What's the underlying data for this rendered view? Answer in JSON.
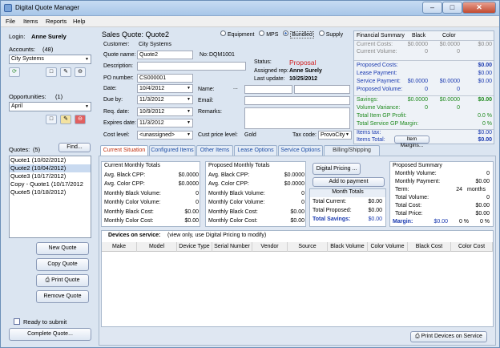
{
  "window": {
    "title": "Digital Quote Manager",
    "minimize": "–",
    "maximize": "□",
    "close": "✕"
  },
  "menu": [
    "File",
    "Items",
    "Reports",
    "Help"
  ],
  "left": {
    "login_label": "Login:",
    "login_user": "Anne Surely",
    "accounts_label": "Accounts:",
    "accounts_count": "(48)",
    "account_selected": "City Systems",
    "opportunities_label": "Opportunities:",
    "opportunities_count": "(1)",
    "opportunity_selected": "April",
    "quotes_label": "Quotes:",
    "quotes_count": "(5)",
    "find_label": "Find...",
    "quotes": [
      "Quote1 (10/02/2012)",
      "Quote2 (10/04/2012)",
      "Quote3 (10/17/2012)",
      "Copy - Quote1 (10/17/2012",
      "Quote5 (10/18/2012)"
    ],
    "new_quote": "New Quote",
    "copy_quote": "Copy Quote",
    "print_quote": "Print Quote",
    "remove_quote": "Remove Quote",
    "ready_label": "Ready to submit",
    "complete_quote": "Complete Quote..."
  },
  "header": {
    "title": "Sales Quote: Quote2",
    "radios": [
      "Equipment",
      "MPS",
      "Bundled",
      "Supply"
    ]
  },
  "form": {
    "customer_label": "Customer:",
    "customer": "City Systems",
    "quote_name_label": "Quote name:",
    "quote_name": "Quote2",
    "no_label": "No:",
    "no": "DQM1001",
    "description_label": "Description:",
    "po_label": "PO number:",
    "po": "CS000001",
    "status_label": "Status:",
    "status": "Proposal",
    "assigned_label": "Assigned rep:",
    "assigned": "Anne Surely",
    "last_update_label": "Last update:",
    "last_update": "10/25/2012",
    "date_label": "Date:",
    "date": "10/4/2012",
    "due_label": "Due by:",
    "due": "11/3/2012",
    "req_label": "Req. date:",
    "req": "10/9/2012",
    "expires_label": "Expires date:",
    "expires": "11/3/2012",
    "cost_level_label": "Cost level:",
    "cost_level": "<unassigned>",
    "name_label": "Name:",
    "name_btn": "...",
    "email_label": "Email:",
    "remarks_label": "Remarks:",
    "cust_price_label": "Cust price level:",
    "cust_price": "Gold",
    "tax_label": "Tax code:",
    "tax": "ProvoCity"
  },
  "financial": {
    "title": "Financial Summary",
    "col_black": "Black",
    "col_color": "Color",
    "current_costs_label": "Current Costs:",
    "current_costs_black": "$0.0000",
    "current_costs_color": "$0.0000",
    "current_costs_total": "$0.00",
    "current_volume_label": "Current Volume:",
    "current_volume_black": "0",
    "current_volume_color": "0",
    "proposed_costs_label": "Proposed Costs:",
    "proposed_costs_total": "$0.00",
    "lease_payment_label": "Lease Payment:",
    "lease_payment_total": "$0.00",
    "service_payment_label": "Service Payment:",
    "service_payment_black": "$0.0000",
    "service_payment_color": "$0.0000",
    "service_payment_total": "$0.00",
    "proposed_volume_label": "Proposed Volume:",
    "proposed_volume_black": "0",
    "proposed_volume_color": "0",
    "savings_label": "Savings:",
    "savings_black": "$0.0000",
    "savings_color": "$0.0000",
    "savings_total": "$0.00",
    "volume_variance_label": "Volume Variance:",
    "volume_variance_black": "0",
    "volume_variance_color": "0",
    "gp_profit_label": "Total Item GP Profit:",
    "gp_profit": "0.0 %",
    "gp_margin_label": "Total Service GP Margin:",
    "gp_margin": "0 %",
    "items_tax_label": "Items tax:",
    "items_tax": "$0.00",
    "items_total_label": "Items Total:",
    "item_margins_btn": "Item Margins...",
    "items_total": "$0.00"
  },
  "tabs": [
    "Current Situation",
    "Configured Items",
    "Other Items",
    "Lease Options",
    "Service Options",
    "Billing/Shipping"
  ],
  "current_monthly": {
    "title": "Current Monthly Totals",
    "rows": [
      [
        "Avg. Black CPP:",
        "$0.0000"
      ],
      [
        "Avg. Color CPP:",
        "$0.0000"
      ],
      [
        "Monthly Black Volume:",
        "0"
      ],
      [
        "Monthly Color Volume:",
        "0"
      ],
      [
        "Monthly Black Cost:",
        "$0.00"
      ],
      [
        "Monthly Color Cost:",
        "$0.00"
      ]
    ]
  },
  "proposed_monthly": {
    "title": "Proposed Monthly Totals",
    "rows": [
      [
        "Avg. Black CPP:",
        "$0.0000"
      ],
      [
        "Avg. Color CPP:",
        "$0.0000"
      ],
      [
        "Monthly Black Volume:",
        "0"
      ],
      [
        "Monthly Color Volume:",
        "0"
      ],
      [
        "Monthly Black Cost:",
        "$0.00"
      ],
      [
        "Monthly Color Cost:",
        "$0.00"
      ]
    ]
  },
  "digital": {
    "pricing_btn": "Digital Pricing ...",
    "add_payment_btn": "Add to payment",
    "month_totals_title": "Month Totals",
    "total_current_label": "Total Current:",
    "total_current": "$0.00",
    "total_proposed_label": "Total Proposed:",
    "total_proposed": "$0.00",
    "total_savings_label": "Total Savings:",
    "total_savings": "$0.00"
  },
  "proposed_summary": {
    "title": "Proposed Summary",
    "monthly_volume_label": "Monthly Volume:",
    "monthly_volume": "0",
    "monthly_payment_label": "Monthly Payment:",
    "monthly_payment": "$0.00",
    "term_label": "Term:",
    "term": "24",
    "term_unit": "months",
    "total_volume_label": "Total Volume:",
    "total_volume": "0",
    "total_cost_label": "Total Cost:",
    "total_cost": "$0.00",
    "total_price_label": "Total Price:",
    "total_price": "$0.00",
    "margin_label": "Margin:",
    "margin_amount": "$0.00",
    "margin_pct1": "0 %",
    "margin_pct2": "0 %"
  },
  "devices": {
    "title": "Devices on service:",
    "note": "(view only, use Digital Pricing to modify)",
    "columns": [
      "Make",
      "Model",
      "Device Type",
      "Serial Number",
      "Vendor",
      "Source",
      "Black Volume",
      "Color Volume",
      "Black Cost",
      "Color Cost"
    ],
    "print_btn": "Print Devices on Service"
  },
  "colors": {
    "accent_blue": "#1a3ab0",
    "savings_green": "#1f8a1f",
    "status_red": "#d22020",
    "window_bg": "#dbe5f1"
  }
}
